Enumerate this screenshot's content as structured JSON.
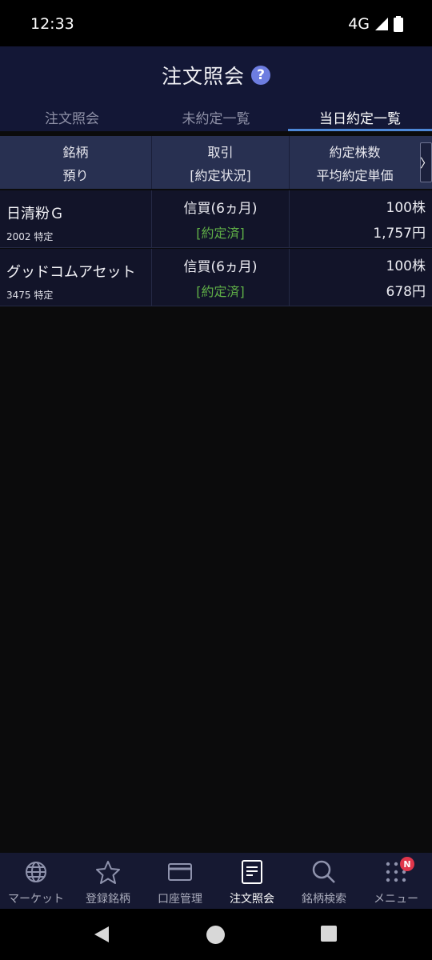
{
  "status_bar": {
    "time": "12:33",
    "network": "4G"
  },
  "header": {
    "title": "注文照会",
    "help_glyph": "?"
  },
  "tabs": [
    {
      "label": "注文照会",
      "active": false
    },
    {
      "label": "未約定一覧",
      "active": false
    },
    {
      "label": "当日約定一覧",
      "active": true
    }
  ],
  "columns": {
    "col1": {
      "line1": "銘柄",
      "line2": "預り"
    },
    "col2": {
      "line1": "取引",
      "line2": "[約定状況]"
    },
    "col3": {
      "line1": "約定株数",
      "line2": "平均約定単価"
    },
    "scroll_glyph": "〉"
  },
  "rows": [
    {
      "name": "日清粉Ｇ",
      "code": "2002 特定",
      "trade": "信買(6ヵ月)",
      "status": "[約定済]",
      "qty": "100株",
      "price": "1,757円"
    },
    {
      "name": "グッドコムアセット",
      "code": "3475 特定",
      "trade": "信買(6ヵ月)",
      "status": "[約定済]",
      "qty": "100株",
      "price": "678円"
    }
  ],
  "bottom_nav": [
    {
      "label": "マーケット",
      "icon": "globe-icon"
    },
    {
      "label": "登録銘柄",
      "icon": "star-icon"
    },
    {
      "label": "口座管理",
      "icon": "card-icon"
    },
    {
      "label": "注文照会",
      "icon": "document-icon",
      "active": true
    },
    {
      "label": "銘柄検索",
      "icon": "search-icon"
    },
    {
      "label": "メニュー",
      "icon": "grid-menu-icon",
      "badge": "N"
    }
  ],
  "colors": {
    "accent": "#4d88d8",
    "status_green": "#5fae47",
    "badge_red": "#e0364b",
    "header_bg": "#131736"
  }
}
